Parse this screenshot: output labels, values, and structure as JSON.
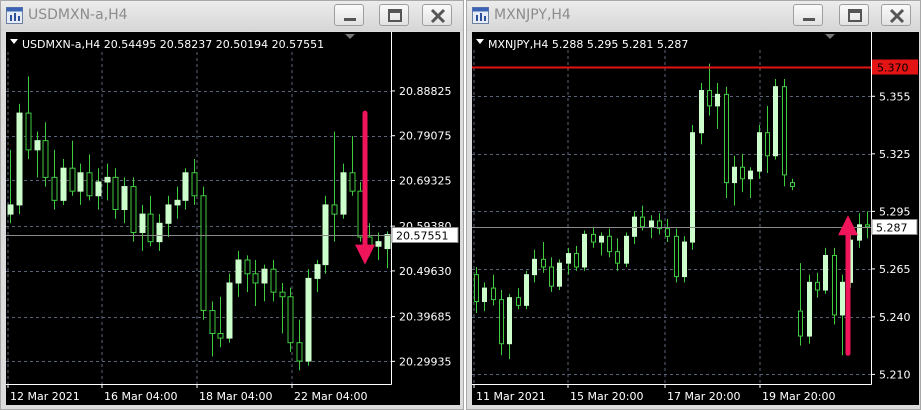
{
  "windows": [
    {
      "title": "USDMXN-a,H4",
      "minimize_icon": "minimize-icon",
      "maximize_icon": "maximize-icon",
      "close_icon": "close-icon"
    },
    {
      "title": "MXNJPY,H4",
      "minimize_icon": "minimize-icon",
      "maximize_icon": "maximize-icon",
      "close_icon": "close-icon"
    }
  ],
  "colors": {
    "background": "#000000",
    "axis": "#ffffff",
    "grid": "#5a6478",
    "candle": "#ccffcc",
    "wick": "#3fcc3f",
    "arrow": "#f0145a",
    "level_line": "#e41414",
    "bid_line": "#8a8a8a"
  },
  "chart_data": [
    {
      "type": "candlestick",
      "symbol": "USDMXN-a,H4",
      "header": "USDMXN-a,H4  20.54495 20.58237 20.50194 20.57551",
      "ohlc_header": {
        "open": 20.54495,
        "high": 20.58237,
        "low": 20.50194,
        "close": 20.57551
      },
      "current_price": "20.57551",
      "ylim": [
        20.25,
        20.96
      ],
      "y_ticks": [
        "20.88825",
        "20.79075",
        "20.69325",
        "20.59380",
        "20.49630",
        "20.39685",
        "20.29935"
      ],
      "x_ticks": [
        "12 Mar 2021",
        "16 Mar 04:00",
        "18 Mar 04:00",
        "22 Mar 04:00"
      ],
      "arrow": {
        "direction": "down",
        "from": 20.84,
        "to": 20.51
      },
      "candles": [
        {
          "o": 20.62,
          "h": 20.76,
          "l": 20.6,
          "c": 20.64
        },
        {
          "o": 20.64,
          "h": 20.86,
          "l": 20.62,
          "c": 20.84
        },
        {
          "o": 20.84,
          "h": 20.92,
          "l": 20.74,
          "c": 20.76
        },
        {
          "o": 20.76,
          "h": 20.8,
          "l": 20.7,
          "c": 20.78
        },
        {
          "o": 20.78,
          "h": 20.82,
          "l": 20.68,
          "c": 20.7
        },
        {
          "o": 20.7,
          "h": 20.76,
          "l": 20.63,
          "c": 20.65
        },
        {
          "o": 20.65,
          "h": 20.74,
          "l": 20.64,
          "c": 20.72
        },
        {
          "o": 20.72,
          "h": 20.78,
          "l": 20.66,
          "c": 20.67
        },
        {
          "o": 20.67,
          "h": 20.73,
          "l": 20.64,
          "c": 20.71
        },
        {
          "o": 20.71,
          "h": 20.75,
          "l": 20.65,
          "c": 20.66
        },
        {
          "o": 20.66,
          "h": 20.72,
          "l": 20.63,
          "c": 20.69
        },
        {
          "o": 20.69,
          "h": 20.73,
          "l": 20.65,
          "c": 20.7
        },
        {
          "o": 20.7,
          "h": 20.72,
          "l": 20.61,
          "c": 20.63
        },
        {
          "o": 20.63,
          "h": 20.7,
          "l": 20.6,
          "c": 20.68
        },
        {
          "o": 20.68,
          "h": 20.7,
          "l": 20.56,
          "c": 20.58
        },
        {
          "o": 20.58,
          "h": 20.64,
          "l": 20.54,
          "c": 20.62
        },
        {
          "o": 20.62,
          "h": 20.66,
          "l": 20.55,
          "c": 20.56
        },
        {
          "o": 20.56,
          "h": 20.62,
          "l": 20.54,
          "c": 20.6
        },
        {
          "o": 20.6,
          "h": 20.66,
          "l": 20.57,
          "c": 20.64
        },
        {
          "o": 20.64,
          "h": 20.68,
          "l": 20.61,
          "c": 20.65
        },
        {
          "o": 20.65,
          "h": 20.72,
          "l": 20.63,
          "c": 20.71
        },
        {
          "o": 20.71,
          "h": 20.74,
          "l": 20.64,
          "c": 20.66
        },
        {
          "o": 20.66,
          "h": 20.68,
          "l": 20.39,
          "c": 20.41
        },
        {
          "o": 20.41,
          "h": 20.43,
          "l": 20.31,
          "c": 20.36
        },
        {
          "o": 20.36,
          "h": 20.44,
          "l": 20.33,
          "c": 20.35
        },
        {
          "o": 20.35,
          "h": 20.49,
          "l": 20.34,
          "c": 20.47
        },
        {
          "o": 20.47,
          "h": 20.54,
          "l": 20.44,
          "c": 20.52
        },
        {
          "o": 20.52,
          "h": 20.53,
          "l": 20.45,
          "c": 20.49
        },
        {
          "o": 20.49,
          "h": 20.52,
          "l": 20.42,
          "c": 20.47
        },
        {
          "o": 20.47,
          "h": 20.51,
          "l": 20.43,
          "c": 20.5
        },
        {
          "o": 20.5,
          "h": 20.52,
          "l": 20.43,
          "c": 20.45
        },
        {
          "o": 20.45,
          "h": 20.47,
          "l": 20.36,
          "c": 20.44
        },
        {
          "o": 20.44,
          "h": 20.46,
          "l": 20.32,
          "c": 20.34
        },
        {
          "o": 20.34,
          "h": 20.39,
          "l": 20.28,
          "c": 20.3
        },
        {
          "o": 20.3,
          "h": 20.5,
          "l": 20.29,
          "c": 20.48
        },
        {
          "o": 20.48,
          "h": 20.52,
          "l": 20.45,
          "c": 20.51
        },
        {
          "o": 20.51,
          "h": 20.66,
          "l": 20.49,
          "c": 20.64
        },
        {
          "o": 20.64,
          "h": 20.8,
          "l": 20.56,
          "c": 20.62
        },
        {
          "o": 20.62,
          "h": 20.73,
          "l": 20.61,
          "c": 20.71
        },
        {
          "o": 20.71,
          "h": 20.79,
          "l": 20.66,
          "c": 20.67
        },
        {
          "o": 20.67,
          "h": 20.69,
          "l": 20.56,
          "c": 20.57
        },
        {
          "o": 20.57,
          "h": 20.6,
          "l": 20.53,
          "c": 20.55
        },
        {
          "o": 20.55,
          "h": 20.58,
          "l": 20.52,
          "c": 20.56
        },
        {
          "o": 20.545,
          "h": 20.58237,
          "l": 20.50194,
          "c": 20.57551
        }
      ]
    },
    {
      "type": "candlestick",
      "symbol": "MXNJPY,H4",
      "header": "MXNJPY,H4  5.288 5.295 5.281 5.287",
      "ohlc_header": {
        "open": 5.288,
        "high": 5.295,
        "low": 5.281,
        "close": 5.287
      },
      "current_price": "5.287",
      "level_price": "5.370",
      "ylim": [
        5.205,
        5.376
      ],
      "y_ticks": [
        "5.355",
        "5.325",
        "5.295",
        "5.265",
        "5.240",
        "5.210"
      ],
      "x_ticks": [
        "11 Mar 2021",
        "15 Mar 20:00",
        "17 Mar 20:00",
        "19 Mar 20:00"
      ],
      "arrow": {
        "direction": "up",
        "from": 5.221,
        "to": 5.293
      },
      "candles": [
        {
          "o": 5.262,
          "h": 5.266,
          "l": 5.242,
          "c": 5.248
        },
        {
          "o": 5.248,
          "h": 5.258,
          "l": 5.243,
          "c": 5.255
        },
        {
          "o": 5.255,
          "h": 5.262,
          "l": 5.246,
          "c": 5.249
        },
        {
          "o": 5.249,
          "h": 5.254,
          "l": 5.22,
          "c": 5.226
        },
        {
          "o": 5.226,
          "h": 5.252,
          "l": 5.218,
          "c": 5.25
        },
        {
          "o": 5.25,
          "h": 5.255,
          "l": 5.244,
          "c": 5.246
        },
        {
          "o": 5.246,
          "h": 5.264,
          "l": 5.244,
          "c": 5.262
        },
        {
          "o": 5.262,
          "h": 5.275,
          "l": 5.258,
          "c": 5.27
        },
        {
          "o": 5.27,
          "h": 5.279,
          "l": 5.263,
          "c": 5.266
        },
        {
          "o": 5.266,
          "h": 5.271,
          "l": 5.253,
          "c": 5.256
        },
        {
          "o": 5.256,
          "h": 5.27,
          "l": 5.254,
          "c": 5.268
        },
        {
          "o": 5.268,
          "h": 5.276,
          "l": 5.262,
          "c": 5.273
        },
        {
          "o": 5.273,
          "h": 5.277,
          "l": 5.264,
          "c": 5.266
        },
        {
          "o": 5.266,
          "h": 5.285,
          "l": 5.264,
          "c": 5.283
        },
        {
          "o": 5.283,
          "h": 5.287,
          "l": 5.276,
          "c": 5.279
        },
        {
          "o": 5.279,
          "h": 5.284,
          "l": 5.272,
          "c": 5.282
        },
        {
          "o": 5.282,
          "h": 5.286,
          "l": 5.271,
          "c": 5.274
        },
        {
          "o": 5.274,
          "h": 5.281,
          "l": 5.264,
          "c": 5.268
        },
        {
          "o": 5.268,
          "h": 5.284,
          "l": 5.266,
          "c": 5.282
        },
        {
          "o": 5.282,
          "h": 5.295,
          "l": 5.278,
          "c": 5.292
        },
        {
          "o": 5.292,
          "h": 5.298,
          "l": 5.285,
          "c": 5.287
        },
        {
          "o": 5.287,
          "h": 5.293,
          "l": 5.281,
          "c": 5.29
        },
        {
          "o": 5.29,
          "h": 5.294,
          "l": 5.283,
          "c": 5.286
        },
        {
          "o": 5.286,
          "h": 5.291,
          "l": 5.279,
          "c": 5.282
        },
        {
          "o": 5.282,
          "h": 5.286,
          "l": 5.258,
          "c": 5.261
        },
        {
          "o": 5.261,
          "h": 5.282,
          "l": 5.258,
          "c": 5.279
        },
        {
          "o": 5.279,
          "h": 5.34,
          "l": 5.275,
          "c": 5.336
        },
        {
          "o": 5.336,
          "h": 5.362,
          "l": 5.33,
          "c": 5.358
        },
        {
          "o": 5.358,
          "h": 5.372,
          "l": 5.345,
          "c": 5.35
        },
        {
          "o": 5.35,
          "h": 5.362,
          "l": 5.338,
          "c": 5.356
        },
        {
          "o": 5.356,
          "h": 5.36,
          "l": 5.302,
          "c": 5.31
        },
        {
          "o": 5.31,
          "h": 5.324,
          "l": 5.298,
          "c": 5.318
        },
        {
          "o": 5.318,
          "h": 5.325,
          "l": 5.305,
          "c": 5.312
        },
        {
          "o": 5.312,
          "h": 5.318,
          "l": 5.302,
          "c": 5.316
        },
        {
          "o": 5.316,
          "h": 5.34,
          "l": 5.312,
          "c": 5.336
        },
        {
          "o": 5.336,
          "h": 5.35,
          "l": 5.315,
          "c": 5.324
        },
        {
          "o": 5.324,
          "h": 5.364,
          "l": 5.322,
          "c": 5.36
        },
        {
          "o": 5.36,
          "h": 5.364,
          "l": 5.308,
          "c": 5.314
        },
        {
          "o": 5.31,
          "h": 5.312,
          "l": 5.306,
          "c": 5.308
        },
        {
          "o": 5.243,
          "h": 5.268,
          "l": 5.225,
          "c": 5.23
        },
        {
          "o": 5.23,
          "h": 5.262,
          "l": 5.226,
          "c": 5.258
        },
        {
          "o": 5.258,
          "h": 5.263,
          "l": 5.25,
          "c": 5.254
        },
        {
          "o": 5.254,
          "h": 5.276,
          "l": 5.252,
          "c": 5.272
        },
        {
          "o": 5.272,
          "h": 5.276,
          "l": 5.236,
          "c": 5.241
        },
        {
          "o": 5.241,
          "h": 5.262,
          "l": 5.22,
          "c": 5.258
        },
        {
          "o": 5.258,
          "h": 5.284,
          "l": 5.255,
          "c": 5.28
        },
        {
          "o": 5.28,
          "h": 5.294,
          "l": 5.276,
          "c": 5.288
        },
        {
          "o": 5.288,
          "h": 5.295,
          "l": 5.281,
          "c": 5.287
        }
      ]
    }
  ]
}
